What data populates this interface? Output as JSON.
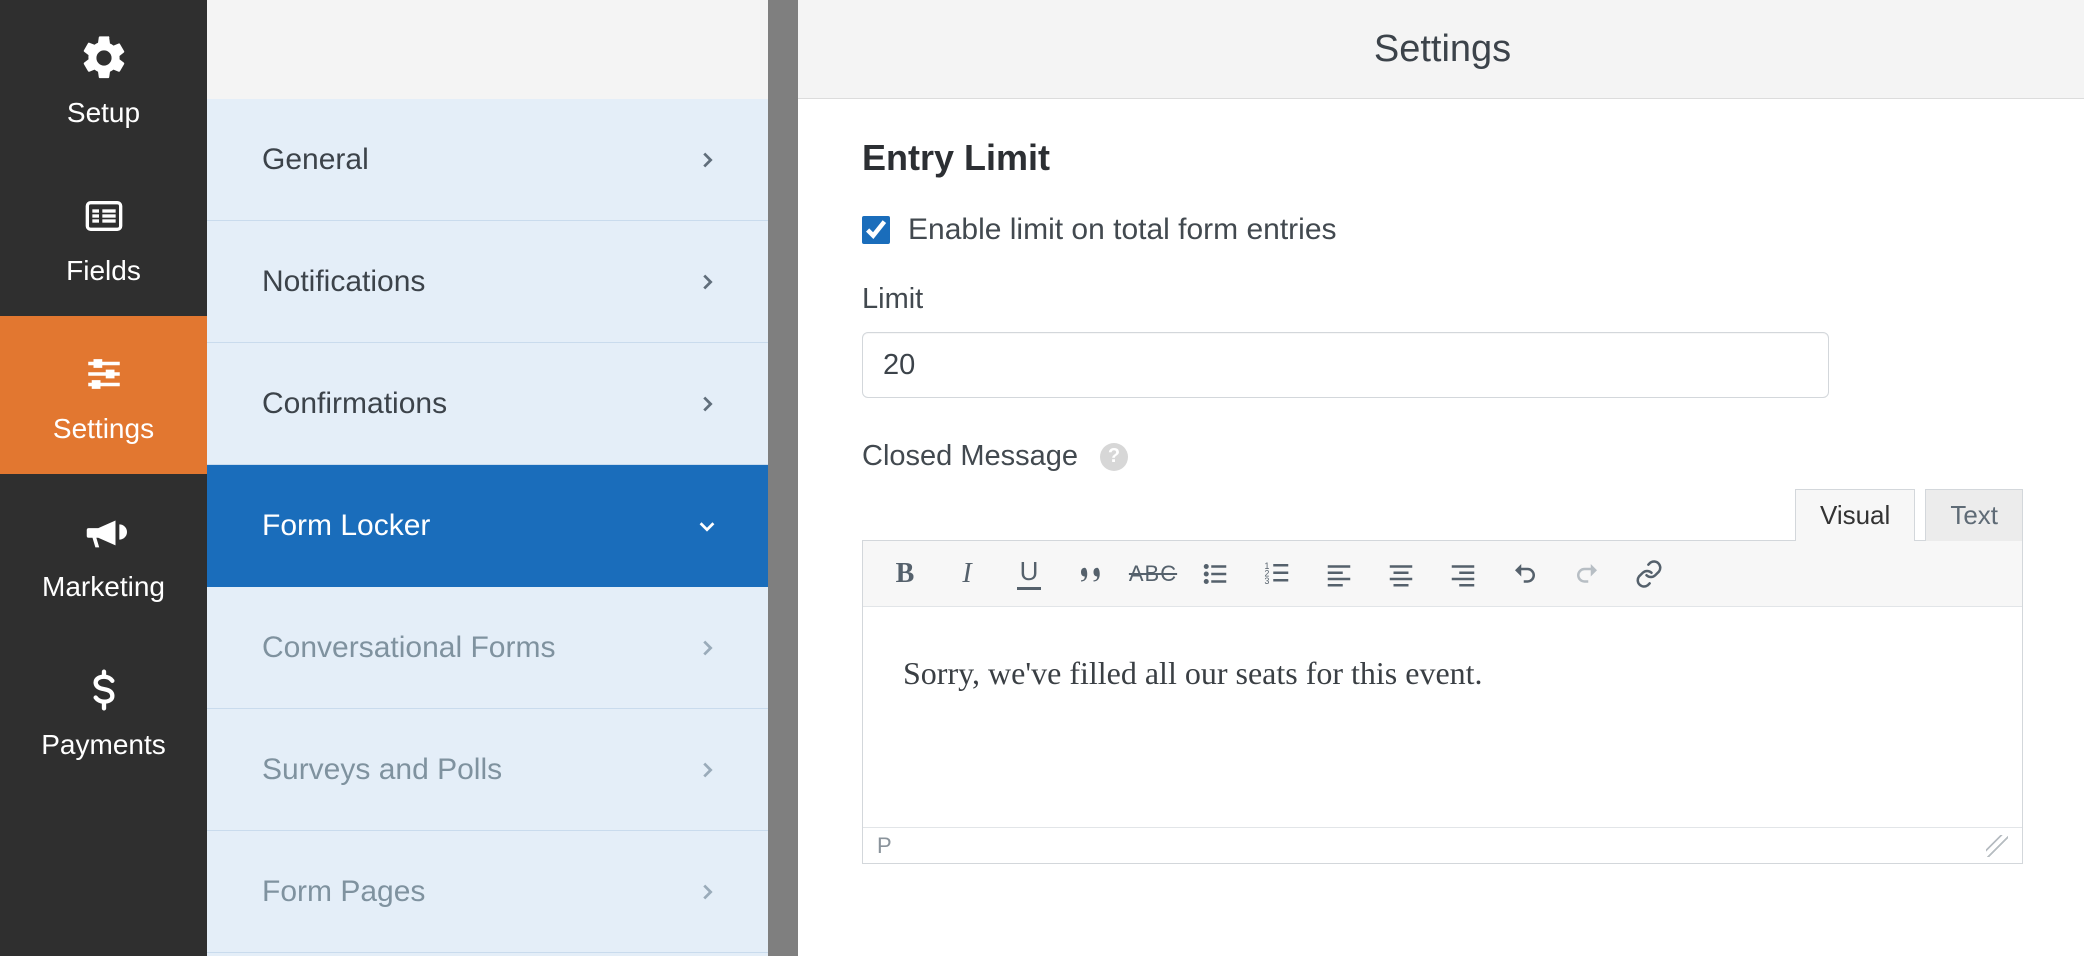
{
  "nav": {
    "items": [
      {
        "label": "Setup"
      },
      {
        "label": "Fields"
      },
      {
        "label": "Settings"
      },
      {
        "label": "Marketing"
      },
      {
        "label": "Payments"
      }
    ]
  },
  "header": {
    "title": "Settings"
  },
  "submenu": {
    "items": [
      {
        "label": "General"
      },
      {
        "label": "Notifications"
      },
      {
        "label": "Confirmations"
      },
      {
        "label": "Form Locker"
      },
      {
        "label": "Conversational Forms"
      },
      {
        "label": "Surveys and Polls"
      },
      {
        "label": "Form Pages"
      }
    ]
  },
  "entry_limit": {
    "section_title": "Entry Limit",
    "enable_label": "Enable limit on total form entries",
    "enable_checked": true,
    "limit_label": "Limit",
    "limit_value": "20",
    "closed_label": "Closed Message",
    "tabs": {
      "visual": "Visual",
      "text": "Text"
    },
    "content": "Sorry, we've filled all our seats for this event.",
    "status_path": "P"
  }
}
